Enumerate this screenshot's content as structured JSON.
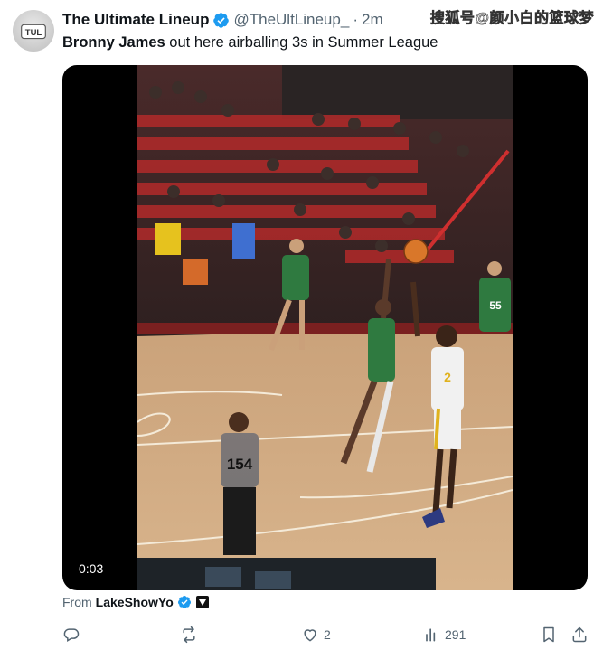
{
  "watermark": "搜狐号@颜小白的篮球梦",
  "tweet": {
    "author_name": "The Ultimate Lineup",
    "handle": "@TheUltLineup_",
    "separator": "·",
    "time": "2m",
    "avatar_text": "TUL",
    "text_mention": "Bronny James",
    "text_rest": " out here airballing 3s in Summer League",
    "verified_color": "#1d9bf0"
  },
  "media": {
    "timestamp": "0:03",
    "referee_number": "154",
    "jersey_numbers": [
      "2",
      "55"
    ]
  },
  "source": {
    "prefix": "From",
    "account": "LakeShowYo"
  },
  "actions": {
    "reply_count": "",
    "retweet_count": "",
    "like_count": "2",
    "views_count": "291"
  }
}
